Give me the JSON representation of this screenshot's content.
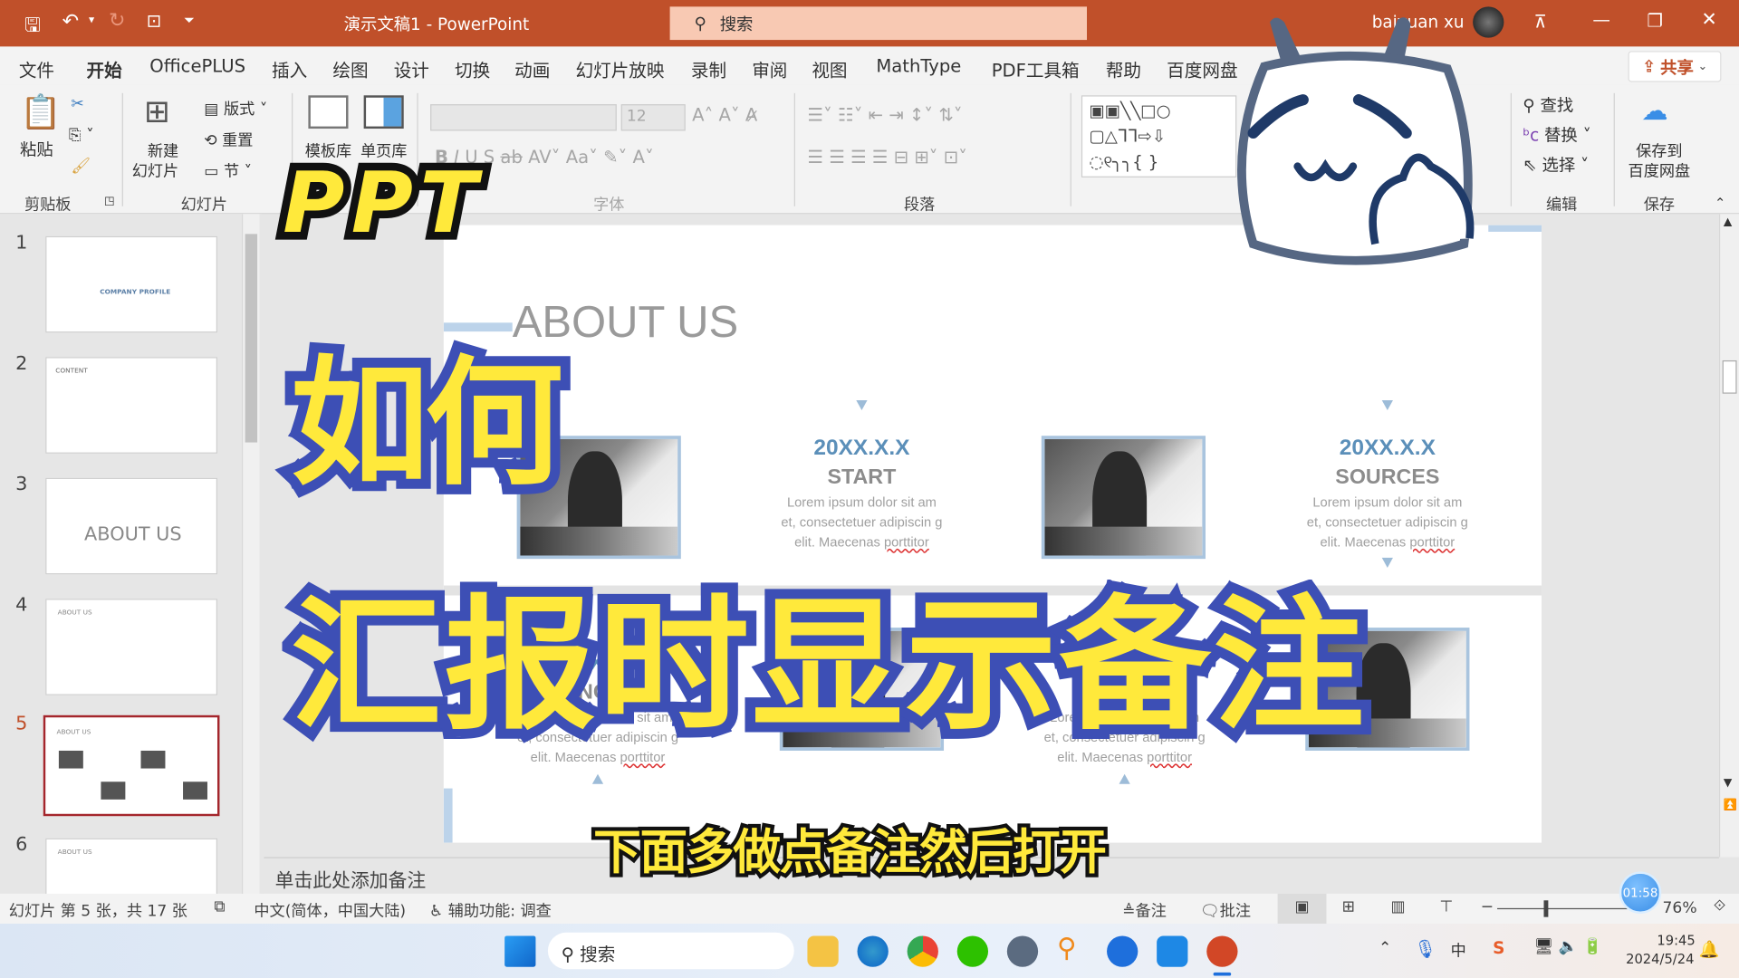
{
  "titlebar": {
    "title": "演示文稿1  -  PowerPoint",
    "search_placeholder": "搜索",
    "user": "baiyuan xu"
  },
  "tabs": [
    "文件",
    "开始",
    "OfficePLUS",
    "插入",
    "绘图",
    "设计",
    "切换",
    "动画",
    "幻灯片放映",
    "录制",
    "审阅",
    "视图",
    "MathType",
    "PDF工具箱",
    "帮助",
    "百度网盘"
  ],
  "active_tab": "开始",
  "share_label": "共享",
  "ribbon": {
    "clipboard": {
      "paste": "粘贴",
      "label": "剪贴板"
    },
    "slides": {
      "new_slide_1": "新建",
      "new_slide_2": "幻灯片",
      "layout": "版式",
      "reset": "重置",
      "section": "节",
      "label": "幻灯片"
    },
    "templates": {
      "template_lib": "模板库",
      "page_lib": "单页库"
    },
    "font": {
      "size": "12",
      "label": "字体"
    },
    "paragraph": {
      "label": "段落"
    },
    "editing": {
      "find": "查找",
      "replace": "替换",
      "select": "选择",
      "label": "编辑"
    },
    "save": {
      "line1": "保存到",
      "line2": "百度网盘",
      "label": "保存"
    }
  },
  "thumbnails": [
    {
      "num": "1",
      "text": "COMPANY PROFILE"
    },
    {
      "num": "2",
      "text": "CONTENT"
    },
    {
      "num": "3",
      "text": "ABOUT US"
    },
    {
      "num": "4",
      "text": "ABOUT US"
    },
    {
      "num": "5",
      "text": "ABOUT US",
      "selected": true
    },
    {
      "num": "6",
      "text": "ABOUT US"
    }
  ],
  "slide": {
    "title": "ABOUT US",
    "items": [
      {
        "date": "20XX.X.X",
        "heading": "START",
        "body": "Lorem ipsum dolor sit am et, consectetuer adipiscin g elit. Maecenas ",
        "link": "porttitor"
      },
      {
        "date": "20XX.X.X",
        "heading": "SOURCES",
        "body": "Lorem ipsum dolor sit am et, consectetuer adipiscin g elit. Maecenas ",
        "link": "porttitor"
      },
      {
        "date": "20XX.X.X",
        "heading": "CONCEPT",
        "body": "Lorem ipsum dolor sit am et, consectetuer adipiscin g elit. Maecenas ",
        "link": "porttitor"
      },
      {
        "date": "20XX.X.X",
        "heading": "PA",
        "body": "Lorem ipsum dolor sit am et, consectetuer adipiscin g elit. Maecenas ",
        "link": "porttitor"
      }
    ]
  },
  "notes_placeholder": "单击此处添加备注",
  "status": {
    "slide_info": "幻灯片 第 5 张，共 17 张",
    "language": "中文(简体，中国大陆)",
    "accessibility": "辅助功能: 调查",
    "notes": "备注",
    "comments": "批注",
    "zoom": "76%",
    "zoom_percent": 76,
    "timer": "01:58"
  },
  "taskbar": {
    "search": "搜索",
    "time": "19:45",
    "date": "2024/5/24",
    "ime": "中"
  },
  "overlay": {
    "ppt": "PPT",
    "line1": "如何",
    "line2": "汇报时显示备注",
    "subtitle": "下面多做点备注然后打开"
  },
  "colors": {
    "titlebar": "#c0502a",
    "accent_blue": "#5b8fb9",
    "overlay_yellow": "#ffe93b",
    "overlay_blue": "#3d4fb5",
    "selected_thumb": "#a4262c"
  }
}
